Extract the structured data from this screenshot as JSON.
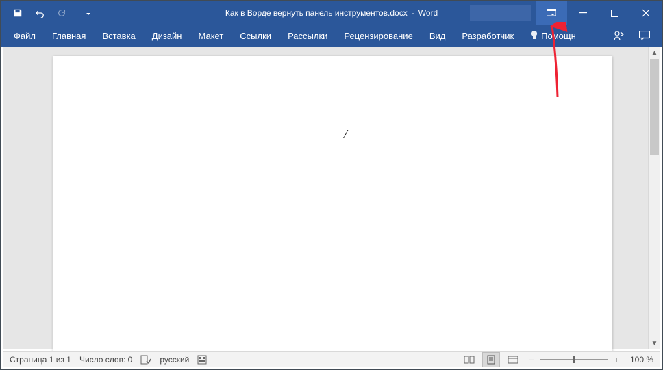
{
  "title": {
    "document": "Как в Ворде вернуть панель инструментов.docx",
    "separator": "-",
    "app": "Word"
  },
  "ribbon": {
    "tabs": [
      "Файл",
      "Главная",
      "Вставка",
      "Дизайн",
      "Макет",
      "Ссылки",
      "Рассылки",
      "Рецензирование",
      "Вид",
      "Разработчик"
    ],
    "tell_me": "Помощн"
  },
  "status": {
    "page": "Страница 1 из 1",
    "words": "Число слов: 0",
    "language": "русский",
    "zoom": "100 %"
  }
}
